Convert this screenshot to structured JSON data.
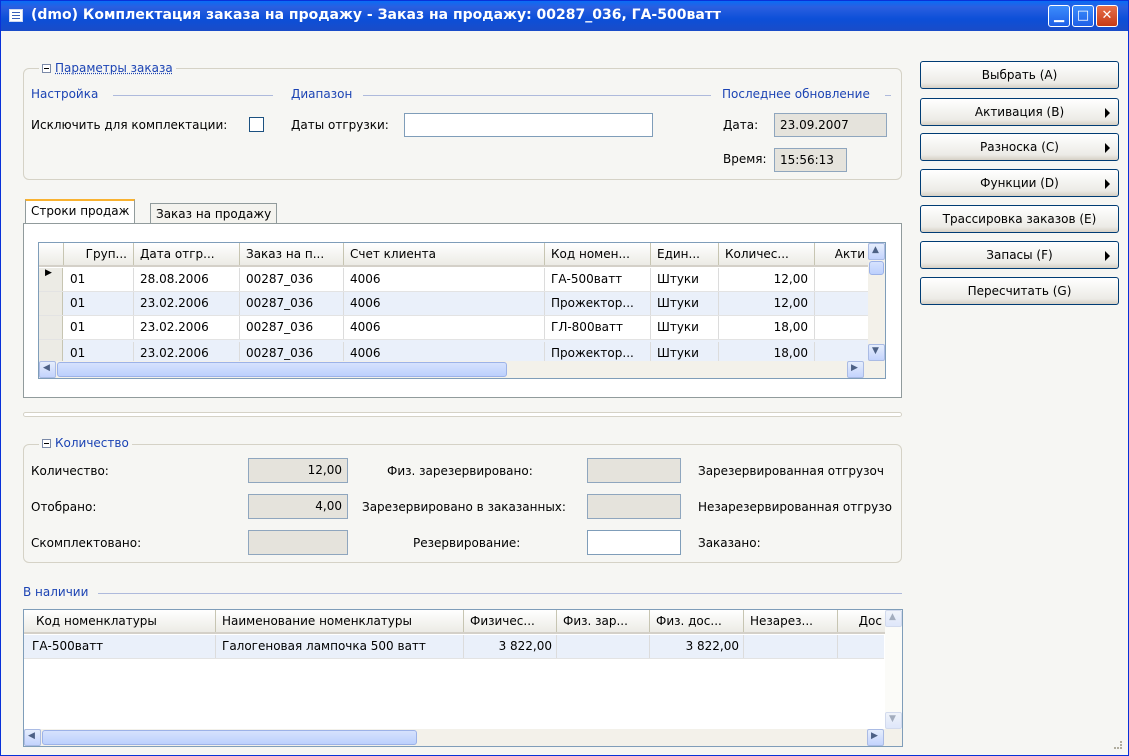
{
  "window": {
    "title": "(dmo) Комплектация заказа на продажу - Заказ на продажу: 00287_036, ГА-500ватт"
  },
  "params": {
    "group_title": "Параметры заказа",
    "setup_label": "Настройка",
    "exclude_label": "Исключить для комплектации:",
    "range_label": "Диапазон",
    "ship_dates_label": "Даты отгрузки:",
    "ship_dates_value": "",
    "last_update_label": "Последнее обновление",
    "date_label": "Дата:",
    "date_value": "23.09.2007",
    "time_label": "Время:",
    "time_value": "15:56:13"
  },
  "tabs": [
    {
      "label": "Строки продаж"
    },
    {
      "label": "Заказ на продажу"
    }
  ],
  "lines": {
    "columns": [
      "Груп...",
      "Дата отгр...",
      "Заказ на п...",
      "Счет клиента",
      "Код номен...",
      "Един...",
      "Количес...",
      "Акти"
    ],
    "rows": [
      [
        "01",
        "28.08.2006",
        "00287_036",
        "4006",
        "ГА-500ватт",
        "Штуки",
        "12,00",
        ""
      ],
      [
        "01",
        "23.02.2006",
        "00287_036",
        "4006",
        "Прожектор...",
        "Штуки",
        "12,00",
        ""
      ],
      [
        "01",
        "23.02.2006",
        "00287_036",
        "4006",
        "ГЛ-800ватт",
        "Штуки",
        "18,00",
        ""
      ],
      [
        "01",
        "23.02.2006",
        "00287_036",
        "4006",
        "Прожектор...",
        "Штуки",
        "18,00",
        ""
      ]
    ]
  },
  "qty": {
    "group_title": "Количество",
    "quantity_label": "Количество:",
    "quantity_value": "12,00",
    "picked_label": "Отобрано:",
    "picked_value": "4,00",
    "completed_label": "Скомплектовано:",
    "completed_value": "",
    "phys_reserved_label": "Физ. зарезервировано:",
    "phys_reserved_value": "",
    "reserved_ordered_label": "Зарезервировано в заказанных:",
    "reserved_ordered_value": "",
    "reservation_label": "Резервирование:",
    "reservation_value": "",
    "reserved_ship_label": "Зарезервированная отгрузоч",
    "unreserved_ship_label": "Незарезервированная отгрузо",
    "ordered_label": "Заказано:"
  },
  "onhand": {
    "title": "В наличии",
    "columns": [
      "Код номенклатуры",
      "Наименование номенклатуры",
      "Физичес...",
      "Физ. зар...",
      "Физ. дос...",
      "Незарез...",
      "Дос"
    ],
    "rows": [
      [
        "ГА-500ватт",
        "Галогеновая лампочка 500 ватт",
        "3 822,00",
        "",
        "3 822,00",
        "",
        ""
      ]
    ]
  },
  "buttons": [
    {
      "label": "Выбрать (A)",
      "arrow": false
    },
    {
      "label": "Активация (B)",
      "arrow": true
    },
    {
      "label": "Разноска (C)",
      "arrow": true
    },
    {
      "label": "Функции (D)",
      "arrow": true
    },
    {
      "label": "Трассировка заказов (E)",
      "arrow": false
    },
    {
      "label": "Запасы (F)",
      "arrow": true
    },
    {
      "label": "Пересчитать (G)",
      "arrow": false
    }
  ]
}
